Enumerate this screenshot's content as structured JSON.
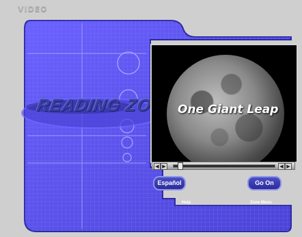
{
  "window": {
    "label": "VIDEO"
  },
  "app": {
    "logo_text": "READING ZONE"
  },
  "video": {
    "title": "One Giant Leap",
    "progress": 0.05
  },
  "buttons": {
    "espanol": "Español",
    "go_on": "Go On"
  },
  "links": {
    "help": "Help",
    "zone_menu": "Zone Menu"
  },
  "colors": {
    "panel": "#5a4fe0",
    "panel_dark": "#2c2a8e",
    "grid": "#8b88ff",
    "backdrop": "#cfcfcf"
  }
}
